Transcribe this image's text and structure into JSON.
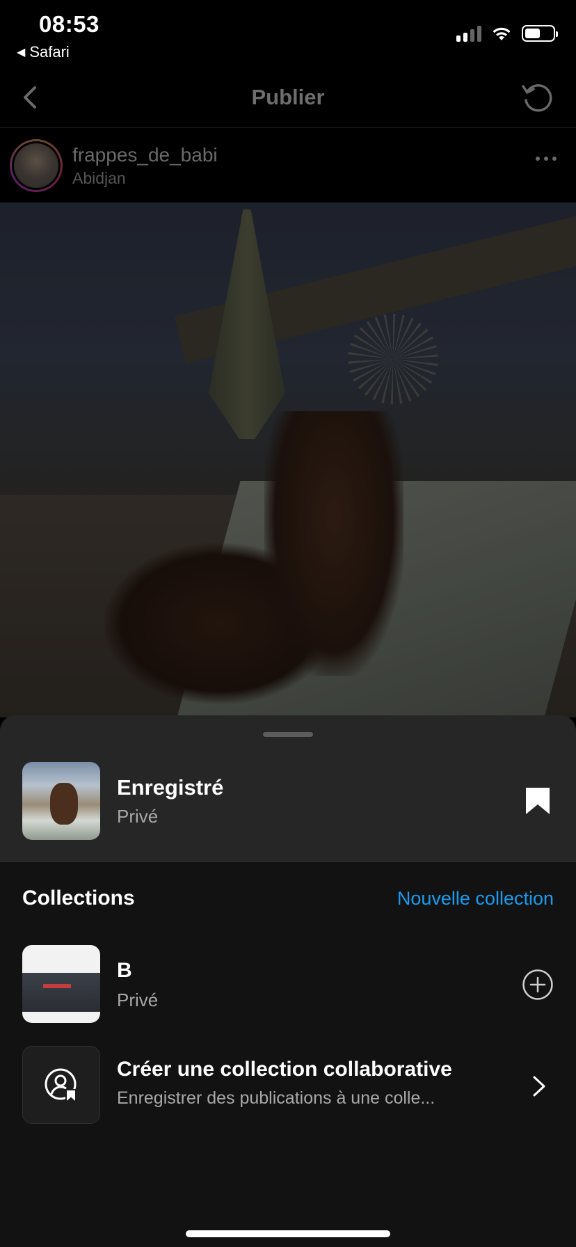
{
  "status_bar": {
    "time": "08:53",
    "back_app": "Safari",
    "back_icon": "triangle-left-icon",
    "icons": [
      "cellular-signal-icon",
      "wifi-icon",
      "battery-icon"
    ]
  },
  "header": {
    "title": "Publier",
    "back_icon": "chevron-left-icon",
    "refresh_icon": "refresh-icon"
  },
  "post": {
    "username": "frappes_de_babi",
    "location": "Abidjan",
    "more_icon": "more-horizontal-icon"
  },
  "sheet": {
    "saved": {
      "title": "Enregistré",
      "subtitle": "Privé",
      "icon": "bookmark-filled-icon"
    },
    "collections_heading": "Collections",
    "new_collection_label": "Nouvelle collection",
    "collections": [
      {
        "title": "B",
        "subtitle": "Privé",
        "action_icon": "plus-circle-icon"
      }
    ],
    "collaborative": {
      "title": "Créer une collection collaborative",
      "subtitle": "Enregistrer des publications à une colle...",
      "icon": "collaborative-collection-icon",
      "chevron_icon": "chevron-right-icon"
    }
  },
  "colors": {
    "background": "#000000",
    "sheet_bg": "#121212",
    "saved_row_bg": "#262626",
    "accent_blue": "#1a9cf0",
    "secondary_text": "#a8a8a8"
  }
}
